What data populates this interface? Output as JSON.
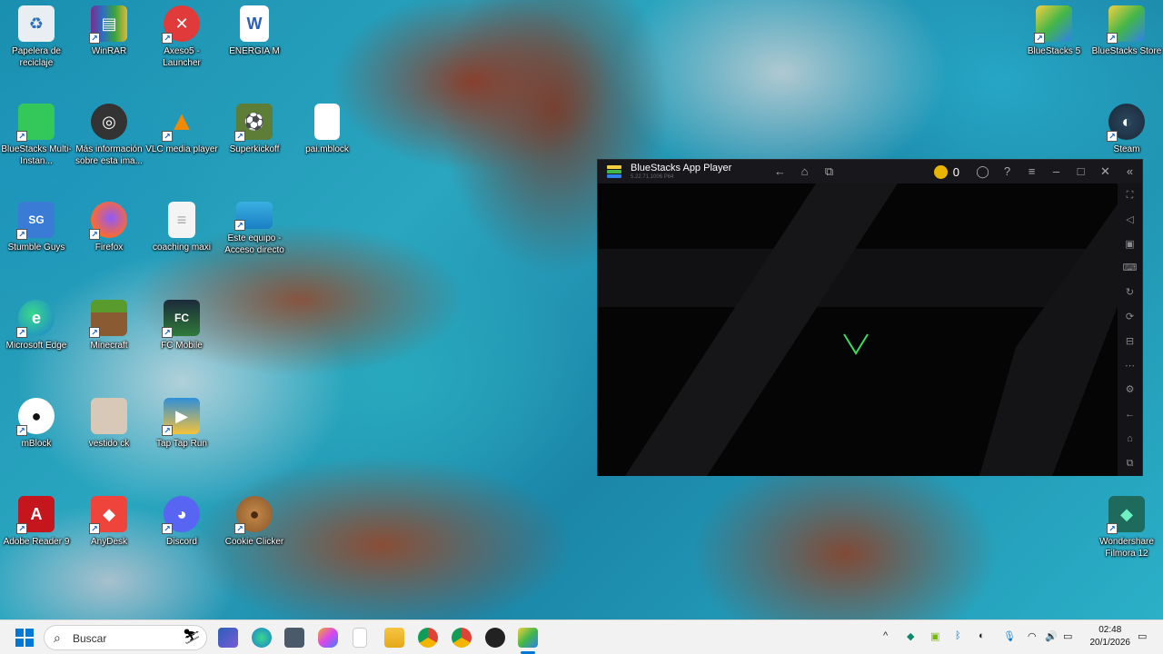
{
  "desktop": {
    "icons": [
      {
        "label": "Papelera de reciclaje",
        "color": "#e8eef2",
        "glyph": "♻",
        "shortcut": false
      },
      {
        "label": "WinRAR",
        "color": "#7b2d8e",
        "glyph": "▤",
        "shortcut": true
      },
      {
        "label": "Axeso5 - Launcher",
        "color": "#e03a3a",
        "glyph": "✕",
        "shortcut": true
      },
      {
        "label": "ENERGIA M",
        "color": "#2b5fb8",
        "glyph": "W",
        "shortcut": false
      },
      {
        "label": "BlueStacks Multi-Instan...",
        "color": "#34c759",
        "glyph": "▬",
        "shortcut": true
      },
      {
        "label": "Más información sobre esta ima...",
        "color": "#333333",
        "glyph": "◎",
        "shortcut": false
      },
      {
        "label": "VLC media player",
        "color": "#f08a00",
        "glyph": "▲",
        "shortcut": true
      },
      {
        "label": "Superkickoff",
        "color": "#5e7d36",
        "glyph": "⚽",
        "shortcut": true
      },
      {
        "label": "pai.mblock",
        "color": "#ffffff",
        "glyph": "",
        "shortcut": false
      },
      {
        "label": "Stumble Guys",
        "color": "#3a7bd5",
        "glyph": "SG",
        "shortcut": true
      },
      {
        "label": "Firefox",
        "color": "#ff6a2a",
        "glyph": "◉",
        "shortcut": true
      },
      {
        "label": "coaching maxi",
        "color": "#f4f4f4",
        "glyph": "≡",
        "shortcut": false
      },
      {
        "label": "Este equipo - Acceso directo",
        "color": "#3ab0e2",
        "glyph": "▭",
        "shortcut": true
      },
      {
        "label": "Microsoft Edge",
        "color": "#1b9de2",
        "glyph": "e",
        "shortcut": true
      },
      {
        "label": "Minecraft",
        "color": "#6b8e23",
        "glyph": "▦",
        "shortcut": true
      },
      {
        "label": "FC Mobile",
        "color": "#1c2a3a",
        "glyph": "FC",
        "shortcut": true
      },
      {
        "label": "mBlock",
        "color": "#ffffff",
        "glyph": "🐼",
        "shortcut": true
      },
      {
        "label": "vestido ck",
        "color": "#d8c8b8",
        "glyph": "",
        "shortcut": false
      },
      {
        "label": "Tap Tap Run",
        "color": "#2f8fd8",
        "glyph": "▶",
        "shortcut": true
      },
      {
        "label": "Adobe Reader 9",
        "color": "#c4161c",
        "glyph": "A",
        "shortcut": true
      },
      {
        "label": "AnyDesk",
        "color": "#ef443b",
        "glyph": "◆",
        "shortcut": true
      },
      {
        "label": "Discord",
        "color": "#5865f2",
        "glyph": "◕",
        "shortcut": true
      },
      {
        "label": "Cookie Clicker",
        "color": "#a0612b",
        "glyph": "●",
        "shortcut": true
      },
      {
        "label": "BlueStacks 5",
        "color": "#43b649",
        "glyph": "▰",
        "shortcut": true
      },
      {
        "label": "BlueStacks Store",
        "color": "#43b649",
        "glyph": "▰",
        "shortcut": true
      },
      {
        "label": "Steam",
        "color": "#1b2838",
        "glyph": "◐",
        "shortcut": true
      },
      {
        "label": "Wondershare Filmora 12",
        "color": "#1e6b5e",
        "glyph": "◆",
        "shortcut": true
      }
    ]
  },
  "bluestacks": {
    "title": "BlueStacks App Player",
    "version": "5.22.71.1006 P64",
    "coin_count": "0",
    "accent": "#3ddc5a"
  },
  "taskbar": {
    "search_placeholder": "Buscar",
    "time": "02:48",
    "date": "20/1/2026"
  }
}
